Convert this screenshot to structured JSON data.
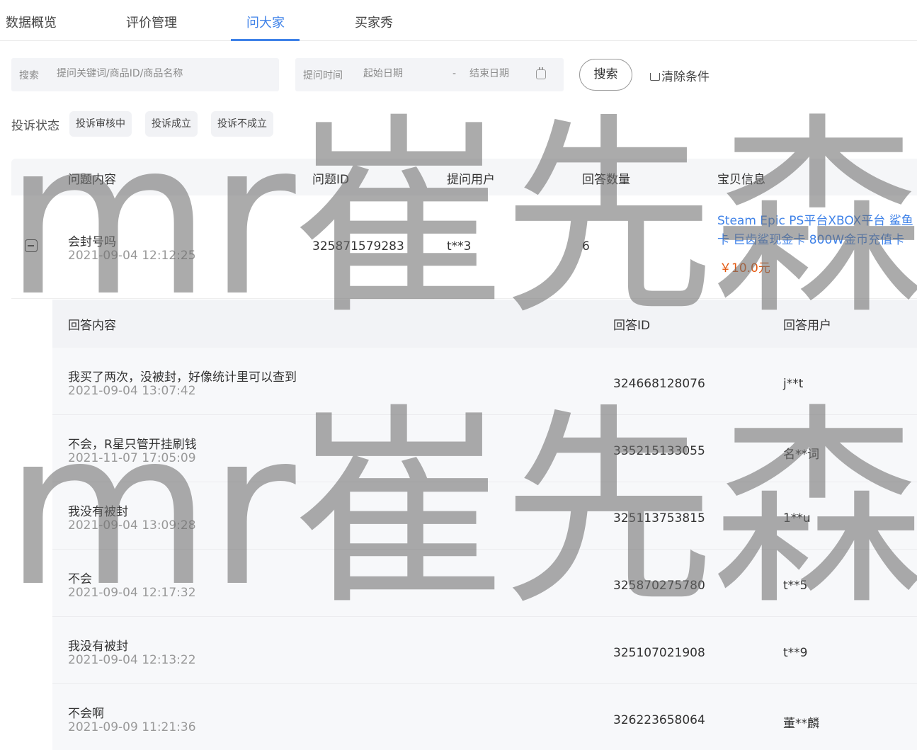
{
  "tabs": [
    {
      "label": "数据概览"
    },
    {
      "label": "评价管理"
    },
    {
      "label": "问大家"
    },
    {
      "label": "买家秀"
    }
  ],
  "filters": {
    "search_label": "搜索",
    "search_placeholder": "提问关键词/商品ID/商品名称",
    "time_label": "提问时间",
    "start_placeholder": "起始日期",
    "date_separator": "-",
    "end_placeholder": "结束日期",
    "search_button": "搜索",
    "clear_button": "清除条件"
  },
  "status": {
    "label": "投诉状态",
    "chips": [
      "投诉审核中",
      "投诉成立",
      "投诉不成立"
    ]
  },
  "question_table": {
    "headers": [
      "问题内容",
      "问题ID",
      "提问用户",
      "回答数量",
      "宝贝信息"
    ],
    "row": {
      "content": "会封号吗",
      "time": "2021-09-04 12:12:25",
      "id": "325871579283",
      "user": "t**3",
      "answer_count": "6",
      "product_title": "Steam Epic PS平台XBOX平台 鲨鱼卡 巨齿鲨现金卡 800W金币充值卡",
      "price": "￥10.0元"
    }
  },
  "answer_table": {
    "headers": [
      "回答内容",
      "回答ID",
      "回答用户"
    ],
    "rows": [
      {
        "text": "我买了两次，没被封，好像统计里可以查到",
        "time": "2021-09-04 13:07:42",
        "id": "324668128076",
        "user": "j**t"
      },
      {
        "text": "不会，R星只管开挂刷钱",
        "time": "2021-11-07 17:05:09",
        "id": "335215133055",
        "user": "名**词"
      },
      {
        "text": "我没有被封",
        "time": "2021-09-04 13:09:28",
        "id": "325113753815",
        "user": "1**u"
      },
      {
        "text": "不会",
        "time": "2021-09-04 12:17:32",
        "id": "325870275780",
        "user": "t**5"
      },
      {
        "text": "我没有被封",
        "time": "2021-09-04 12:13:22",
        "id": "325107021908",
        "user": "t**9"
      },
      {
        "text": "不会啊",
        "time": "2021-09-09 11:21:36",
        "id": "326223658064",
        "user": "董**麟"
      }
    ]
  },
  "watermark": "mr崔先森"
}
